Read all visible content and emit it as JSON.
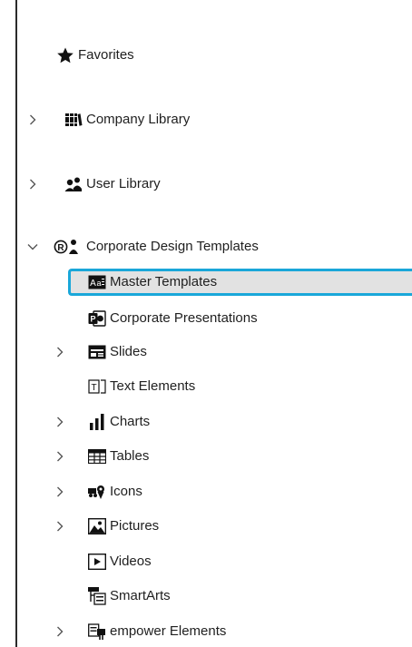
{
  "tree": {
    "favorites": {
      "label": "Favorites",
      "icon": "star-icon"
    },
    "company_library": {
      "label": "Company Library",
      "icon": "books-icon",
      "expanded": false
    },
    "user_library": {
      "label": "User Library",
      "icon": "users-icon",
      "expanded": false
    },
    "corporate_design_templates": {
      "label": "Corporate Design Templates",
      "icon": "registered-user-icon",
      "expanded": true,
      "children": [
        {
          "label": "Master Templates",
          "icon": "master-template-icon",
          "selected": true,
          "has_children": false
        },
        {
          "label": "Corporate Presentations",
          "icon": "powerpoint-icon",
          "has_children": false
        },
        {
          "label": "Slides",
          "icon": "slide-icon",
          "has_children": true
        },
        {
          "label": "Text Elements",
          "icon": "text-element-icon",
          "has_children": false
        },
        {
          "label": "Charts",
          "icon": "bar-chart-icon",
          "has_children": true
        },
        {
          "label": "Tables",
          "icon": "table-icon",
          "has_children": true
        },
        {
          "label": "Icons",
          "icon": "icons-icon",
          "has_children": true
        },
        {
          "label": "Pictures",
          "icon": "picture-icon",
          "has_children": true
        },
        {
          "label": "Videos",
          "icon": "video-icon",
          "has_children": false
        },
        {
          "label": "SmartArts",
          "icon": "smartart-icon",
          "has_children": false
        },
        {
          "label": "empower Elements",
          "icon": "empower-elements-icon",
          "has_children": true
        }
      ]
    }
  },
  "colors": {
    "selection_border": "#1aa7d9",
    "selection_fill": "#e2e2e2",
    "text": "#1f1f1f"
  }
}
